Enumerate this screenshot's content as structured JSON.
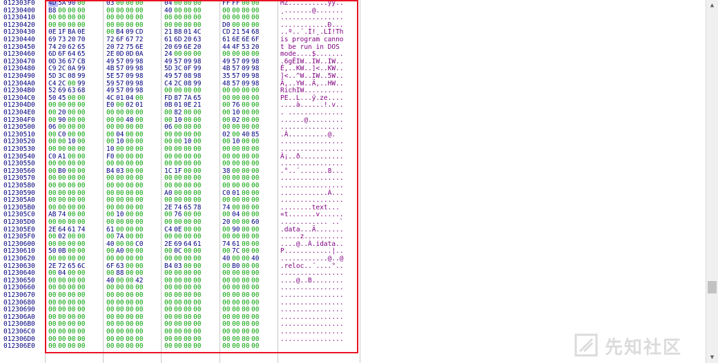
{
  "rows": [
    {
      "addr": "012303F0",
      "bytes": [
        "4D",
        "5A",
        "90",
        "00",
        "03",
        "00",
        "00",
        "00",
        "04",
        "00",
        "00",
        "00",
        "FF",
        "FF",
        "00",
        "00"
      ],
      "ascii": "MZ..........ÿÿ.."
    },
    {
      "addr": "01230400",
      "bytes": [
        "B8",
        "00",
        "00",
        "00",
        "00",
        "00",
        "00",
        "00",
        "40",
        "00",
        "00",
        "00",
        "00",
        "00",
        "00",
        "00"
      ],
      "ascii": "¸.......@......."
    },
    {
      "addr": "01230410",
      "bytes": [
        "00",
        "00",
        "00",
        "00",
        "00",
        "00",
        "00",
        "00",
        "00",
        "00",
        "00",
        "00",
        "00",
        "00",
        "00",
        "00"
      ],
      "ascii": "................"
    },
    {
      "addr": "01230420",
      "bytes": [
        "00",
        "00",
        "00",
        "00",
        "00",
        "00",
        "00",
        "00",
        "00",
        "00",
        "00",
        "00",
        "D0",
        "00",
        "00",
        "00"
      ],
      "ascii": "............Ð..."
    },
    {
      "addr": "01230430",
      "bytes": [
        "0E",
        "1F",
        "BA",
        "0E",
        "00",
        "B4",
        "09",
        "CD",
        "21",
        "B8",
        "01",
        "4C",
        "CD",
        "21",
        "54",
        "68"
      ],
      "ascii": "..º..´.Í!¸.LÍ!Th"
    },
    {
      "addr": "01230440",
      "bytes": [
        "69",
        "73",
        "20",
        "70",
        "72",
        "6F",
        "67",
        "72",
        "61",
        "6D",
        "20",
        "63",
        "61",
        "6E",
        "6E",
        "6F"
      ],
      "ascii": "is program canno"
    },
    {
      "addr": "01230450",
      "bytes": [
        "74",
        "20",
        "62",
        "65",
        "20",
        "72",
        "75",
        "6E",
        "20",
        "69",
        "6E",
        "20",
        "44",
        "4F",
        "53",
        "20"
      ],
      "ascii": "t be run in DOS "
    },
    {
      "addr": "01230460",
      "bytes": [
        "6D",
        "6F",
        "64",
        "65",
        "2E",
        "0D",
        "0D",
        "0A",
        "24",
        "00",
        "00",
        "00",
        "00",
        "00",
        "00",
        "00"
      ],
      "ascii": "mode....$......."
    },
    {
      "addr": "01230470",
      "bytes": [
        "0D",
        "36",
        "67",
        "CB",
        "49",
        "57",
        "09",
        "98",
        "49",
        "57",
        "09",
        "98",
        "49",
        "57",
        "09",
        "98"
      ],
      "ascii": ".6gËIW..IW..IW.."
    },
    {
      "addr": "01230480",
      "bytes": [
        "C9",
        "2C",
        "0A",
        "99",
        "4B",
        "57",
        "09",
        "98",
        "5D",
        "3C",
        "0F",
        "99",
        "4B",
        "57",
        "09",
        "98"
      ],
      "ascii": "É,..KW..]<..KW.."
    },
    {
      "addr": "01230490",
      "bytes": [
        "5D",
        "3C",
        "08",
        "99",
        "5E",
        "57",
        "09",
        "98",
        "49",
        "57",
        "08",
        "98",
        "35",
        "57",
        "09",
        "98"
      ],
      "ascii": "]<..^W..IW..5W.."
    },
    {
      "addr": "012304A0",
      "bytes": [
        "C4",
        "2C",
        "00",
        "99",
        "59",
        "57",
        "09",
        "98",
        "C4",
        "2C",
        "08",
        "99",
        "48",
        "57",
        "09",
        "98"
      ],
      "ascii": "Ä,..YW..Ä,..HW.."
    },
    {
      "addr": "012304B0",
      "bytes": [
        "52",
        "69",
        "63",
        "68",
        "49",
        "57",
        "09",
        "98",
        "00",
        "00",
        "00",
        "00",
        "00",
        "00",
        "00",
        "00"
      ],
      "ascii": "RichIW.........."
    },
    {
      "addr": "012304C0",
      "bytes": [
        "50",
        "45",
        "00",
        "00",
        "4C",
        "01",
        "04",
        "00",
        "FD",
        "87",
        "7A",
        "65",
        "00",
        "00",
        "00",
        "00"
      ],
      "ascii": "PE..L...ý.ze...."
    },
    {
      "addr": "012304D0",
      "bytes": [
        "00",
        "00",
        "00",
        "00",
        "E0",
        "00",
        "02",
        "01",
        "0B",
        "01",
        "0E",
        "21",
        "00",
        "76",
        "00",
        "00"
      ],
      "ascii": "....à......!.v.."
    },
    {
      "addr": "012304E0",
      "bytes": [
        "00",
        "20",
        "00",
        "00",
        "00",
        "00",
        "00",
        "00",
        "00",
        "82",
        "00",
        "00",
        "00",
        "10",
        "00",
        "00"
      ],
      "ascii": ". .............."
    },
    {
      "addr": "012304F0",
      "bytes": [
        "00",
        "90",
        "00",
        "00",
        "00",
        "00",
        "40",
        "00",
        "00",
        "10",
        "00",
        "00",
        "00",
        "02",
        "00",
        "00"
      ],
      "ascii": "......@........."
    },
    {
      "addr": "01230500",
      "bytes": [
        "06",
        "00",
        "00",
        "00",
        "00",
        "00",
        "00",
        "00",
        "06",
        "00",
        "00",
        "00",
        "00",
        "00",
        "00",
        "00"
      ],
      "ascii": "................"
    },
    {
      "addr": "01230510",
      "bytes": [
        "00",
        "C0",
        "00",
        "00",
        "00",
        "04",
        "00",
        "00",
        "00",
        "00",
        "00",
        "00",
        "02",
        "00",
        "40",
        "85"
      ],
      "ascii": ".À..........@."
    },
    {
      "addr": "01230520",
      "bytes": [
        "00",
        "00",
        "10",
        "00",
        "00",
        "10",
        "00",
        "00",
        "00",
        "00",
        "10",
        "00",
        "00",
        "10",
        "00",
        "00"
      ],
      "ascii": "................"
    },
    {
      "addr": "01230530",
      "bytes": [
        "00",
        "00",
        "00",
        "00",
        "10",
        "00",
        "00",
        "00",
        "00",
        "00",
        "00",
        "00",
        "00",
        "00",
        "00",
        "00"
      ],
      "ascii": "................"
    },
    {
      "addr": "01230540",
      "bytes": [
        "C0",
        "A1",
        "00",
        "00",
        "F0",
        "00",
        "00",
        "00",
        "00",
        "00",
        "00",
        "00",
        "00",
        "00",
        "00",
        "00"
      ],
      "ascii": "À¡..ð..........."
    },
    {
      "addr": "01230550",
      "bytes": [
        "00",
        "00",
        "00",
        "00",
        "00",
        "00",
        "00",
        "00",
        "00",
        "00",
        "00",
        "00",
        "00",
        "00",
        "00",
        "00"
      ],
      "ascii": "................"
    },
    {
      "addr": "01230560",
      "bytes": [
        "00",
        "B0",
        "00",
        "00",
        "B4",
        "03",
        "00",
        "00",
        "1C",
        "1F",
        "00",
        "00",
        "38",
        "00",
        "00",
        "00"
      ],
      "ascii": ".°..´.......8..."
    },
    {
      "addr": "01230570",
      "bytes": [
        "00",
        "00",
        "00",
        "00",
        "00",
        "00",
        "00",
        "00",
        "00",
        "00",
        "00",
        "00",
        "00",
        "00",
        "00",
        "00"
      ],
      "ascii": "................"
    },
    {
      "addr": "01230580",
      "bytes": [
        "00",
        "00",
        "00",
        "00",
        "00",
        "00",
        "00",
        "00",
        "00",
        "00",
        "00",
        "00",
        "00",
        "00",
        "00",
        "00"
      ],
      "ascii": "................"
    },
    {
      "addr": "01230590",
      "bytes": [
        "00",
        "00",
        "00",
        "00",
        "00",
        "00",
        "00",
        "00",
        "A0",
        "00",
        "00",
        "00",
        "C0",
        "01",
        "00",
        "00"
      ],
      "ascii": "............À..."
    },
    {
      "addr": "012305A0",
      "bytes": [
        "00",
        "00",
        "00",
        "00",
        "00",
        "00",
        "00",
        "00",
        "00",
        "00",
        "00",
        "00",
        "00",
        "00",
        "00",
        "00"
      ],
      "ascii": "................"
    },
    {
      "addr": "012305B0",
      "bytes": [
        "00",
        "00",
        "00",
        "00",
        "00",
        "00",
        "00",
        "00",
        "2E",
        "74",
        "65",
        "78",
        "74",
        "00",
        "00",
        "00"
      ],
      "ascii": "........text..."
    },
    {
      "addr": "012305C0",
      "bytes": [
        "AB",
        "74",
        "00",
        "00",
        "00",
        "10",
        "00",
        "00",
        "00",
        "76",
        "00",
        "00",
        "00",
        "04",
        "00",
        "00"
      ],
      "ascii": "«t.......v......"
    },
    {
      "addr": "012305D0",
      "bytes": [
        "00",
        "00",
        "00",
        "00",
        "00",
        "00",
        "00",
        "00",
        "00",
        "00",
        "00",
        "00",
        "20",
        "00",
        "00",
        "60"
      ],
      "ascii": "............ ..`"
    },
    {
      "addr": "012305E0",
      "bytes": [
        "2E",
        "64",
        "61",
        "74",
        "61",
        "00",
        "00",
        "00",
        "C4",
        "0E",
        "00",
        "00",
        "00",
        "90",
        "00",
        "00"
      ],
      "ascii": ".data...Ä......."
    },
    {
      "addr": "012305F0",
      "bytes": [
        "00",
        "02",
        "00",
        "00",
        "00",
        "7A",
        "00",
        "00",
        "00",
        "00",
        "00",
        "00",
        "00",
        "00",
        "00",
        "00"
      ],
      "ascii": ".....z.........."
    },
    {
      "addr": "01230600",
      "bytes": [
        "00",
        "00",
        "00",
        "00",
        "40",
        "00",
        "00",
        "C0",
        "2E",
        "69",
        "64",
        "61",
        "74",
        "61",
        "00",
        "00"
      ],
      "ascii": "....@..À.idata.."
    },
    {
      "addr": "01230610",
      "bytes": [
        "50",
        "0B",
        "00",
        "00",
        "00",
        "A0",
        "00",
        "00",
        "00",
        "0C",
        "00",
        "00",
        "00",
        "7C",
        "00",
        "00"
      ],
      "ascii": "P............|.."
    },
    {
      "addr": "01230620",
      "bytes": [
        "00",
        "00",
        "00",
        "00",
        "00",
        "00",
        "00",
        "00",
        "00",
        "00",
        "00",
        "00",
        "40",
        "00",
        "00",
        "40"
      ],
      "ascii": "............@..@"
    },
    {
      "addr": "01230630",
      "bytes": [
        "2E",
        "72",
        "65",
        "6C",
        "6F",
        "63",
        "00",
        "00",
        "B4",
        "03",
        "00",
        "00",
        "00",
        "B0",
        "00",
        "00"
      ],
      "ascii": ".reloc..´....°.."
    },
    {
      "addr": "01230640",
      "bytes": [
        "00",
        "04",
        "00",
        "00",
        "00",
        "88",
        "00",
        "00",
        "00",
        "00",
        "00",
        "00",
        "00",
        "00",
        "00",
        "00"
      ],
      "ascii": "................"
    },
    {
      "addr": "01230650",
      "bytes": [
        "00",
        "00",
        "00",
        "00",
        "40",
        "00",
        "00",
        "42",
        "00",
        "00",
        "00",
        "00",
        "00",
        "00",
        "00",
        "00"
      ],
      "ascii": "....@..B........"
    },
    {
      "addr": "01230660",
      "bytes": [
        "00",
        "00",
        "00",
        "00",
        "00",
        "00",
        "00",
        "00",
        "00",
        "00",
        "00",
        "00",
        "00",
        "00",
        "00",
        "00"
      ],
      "ascii": "................"
    },
    {
      "addr": "01230670",
      "bytes": [
        "00",
        "00",
        "00",
        "00",
        "00",
        "00",
        "00",
        "00",
        "00",
        "00",
        "00",
        "00",
        "00",
        "00",
        "00",
        "00"
      ],
      "ascii": "................"
    },
    {
      "addr": "01230680",
      "bytes": [
        "00",
        "00",
        "00",
        "00",
        "00",
        "00",
        "00",
        "00",
        "00",
        "00",
        "00",
        "00",
        "00",
        "00",
        "00",
        "00"
      ],
      "ascii": "................"
    },
    {
      "addr": "01230690",
      "bytes": [
        "00",
        "00",
        "00",
        "00",
        "00",
        "00",
        "00",
        "00",
        "00",
        "00",
        "00",
        "00",
        "00",
        "00",
        "00",
        "00"
      ],
      "ascii": "................"
    },
    {
      "addr": "012306A0",
      "bytes": [
        "00",
        "00",
        "00",
        "00",
        "00",
        "00",
        "00",
        "00",
        "00",
        "00",
        "00",
        "00",
        "00",
        "00",
        "00",
        "00"
      ],
      "ascii": "................"
    },
    {
      "addr": "012306B0",
      "bytes": [
        "00",
        "00",
        "00",
        "00",
        "00",
        "00",
        "00",
        "00",
        "00",
        "00",
        "00",
        "00",
        "00",
        "00",
        "00",
        "00"
      ],
      "ascii": "................"
    },
    {
      "addr": "012306C0",
      "bytes": [
        "00",
        "00",
        "00",
        "00",
        "00",
        "00",
        "00",
        "00",
        "00",
        "00",
        "00",
        "00",
        "00",
        "00",
        "00",
        "00"
      ],
      "ascii": "................"
    },
    {
      "addr": "012306D0",
      "bytes": [
        "00",
        "00",
        "00",
        "00",
        "00",
        "00",
        "00",
        "00",
        "00",
        "00",
        "00",
        "00",
        "00",
        "00",
        "00",
        "00"
      ],
      "ascii": "................"
    },
    {
      "addr": "012306E0",
      "bytes": [
        "00",
        "00",
        "00",
        "00",
        "00",
        "00",
        "00",
        "00",
        "00",
        "00",
        "00",
        "00",
        "00",
        "00",
        "00",
        "00"
      ],
      "ascii": ""
    }
  ],
  "selected_byte": {
    "row": 0,
    "col": 0
  },
  "colors": {
    "zero_byte": "#00a000",
    "nonzero_byte": "#000080",
    "ascii": "#800080",
    "highlight_box": "#e81123"
  },
  "watermark": {
    "text": "先知社区",
    "logo_icon": "xianzhi-logo-icon"
  },
  "scrollbar": {
    "up_icon": "▲",
    "down_icon": "▼"
  }
}
